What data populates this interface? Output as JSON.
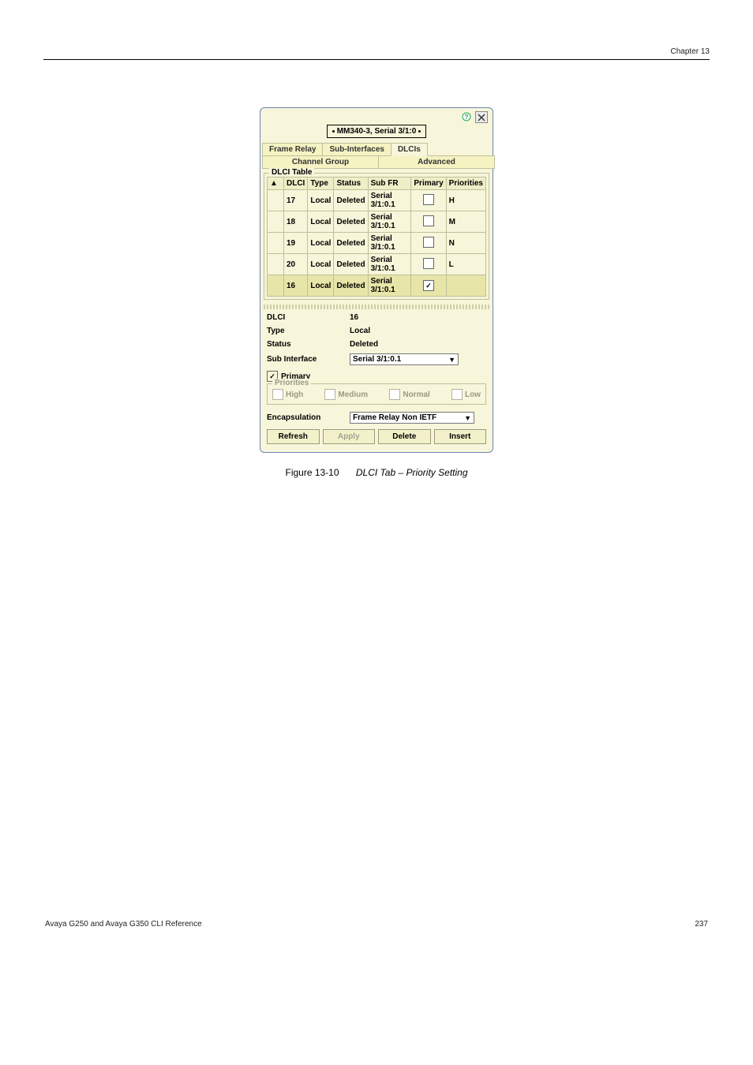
{
  "header": {
    "chapter": "Chapter 13"
  },
  "panel": {
    "breadcrumb": "MM340-3, Serial 3/1:0",
    "tabs": {
      "frame_relay": "Frame Relay",
      "sub_interfaces": "Sub-Interfaces",
      "dlcis": "DLCIs",
      "channel_group": "Channel Group",
      "advanced": "Advanced"
    },
    "table_legend": "DLCI Table",
    "columns": {
      "sort": "▲",
      "dlci": "DLCI",
      "type": "Type",
      "status": "Status",
      "subfr": "Sub FR",
      "primary": "Primary",
      "priorities": "Priorities"
    },
    "rows": [
      {
        "dlci": "17",
        "type": "Local",
        "status": "Deleted",
        "subfr": "Serial 3/1:0.1",
        "primary": false,
        "prio": "H"
      },
      {
        "dlci": "18",
        "type": "Local",
        "status": "Deleted",
        "subfr": "Serial 3/1:0.1",
        "primary": false,
        "prio": "M"
      },
      {
        "dlci": "19",
        "type": "Local",
        "status": "Deleted",
        "subfr": "Serial 3/1:0.1",
        "primary": false,
        "prio": "N"
      },
      {
        "dlci": "20",
        "type": "Local",
        "status": "Deleted",
        "subfr": "Serial 3/1:0.1",
        "primary": false,
        "prio": "L"
      },
      {
        "dlci": "16",
        "type": "Local",
        "status": "Deleted",
        "subfr": "Serial 3/1:0.1",
        "primary": true,
        "prio": ""
      }
    ],
    "form": {
      "dlci_label": "DLCI",
      "dlci_value": "16",
      "type_label": "Type",
      "type_value": "Local",
      "status_label": "Status",
      "status_value": "Deleted",
      "subif_label": "Sub Interface",
      "subif_value": "Serial 3/1:0.1",
      "primary_label": "Primary",
      "priorities_legend": "Priorities",
      "prio_high": "High",
      "prio_medium": "Medium",
      "prio_normal": "Normal",
      "prio_low": "Low",
      "encap_label": "Encapsulation",
      "encap_value": "Frame Relay Non IETF"
    },
    "buttons": {
      "refresh": "Refresh",
      "apply": "Apply",
      "delete": "Delete",
      "insert": "Insert"
    }
  },
  "figure": {
    "number": "Figure 13-10",
    "title": "DLCI Tab – Priority Setting"
  },
  "footer": {
    "left": "Avaya G250 and Avaya G350 CLI Reference",
    "right": "237"
  }
}
